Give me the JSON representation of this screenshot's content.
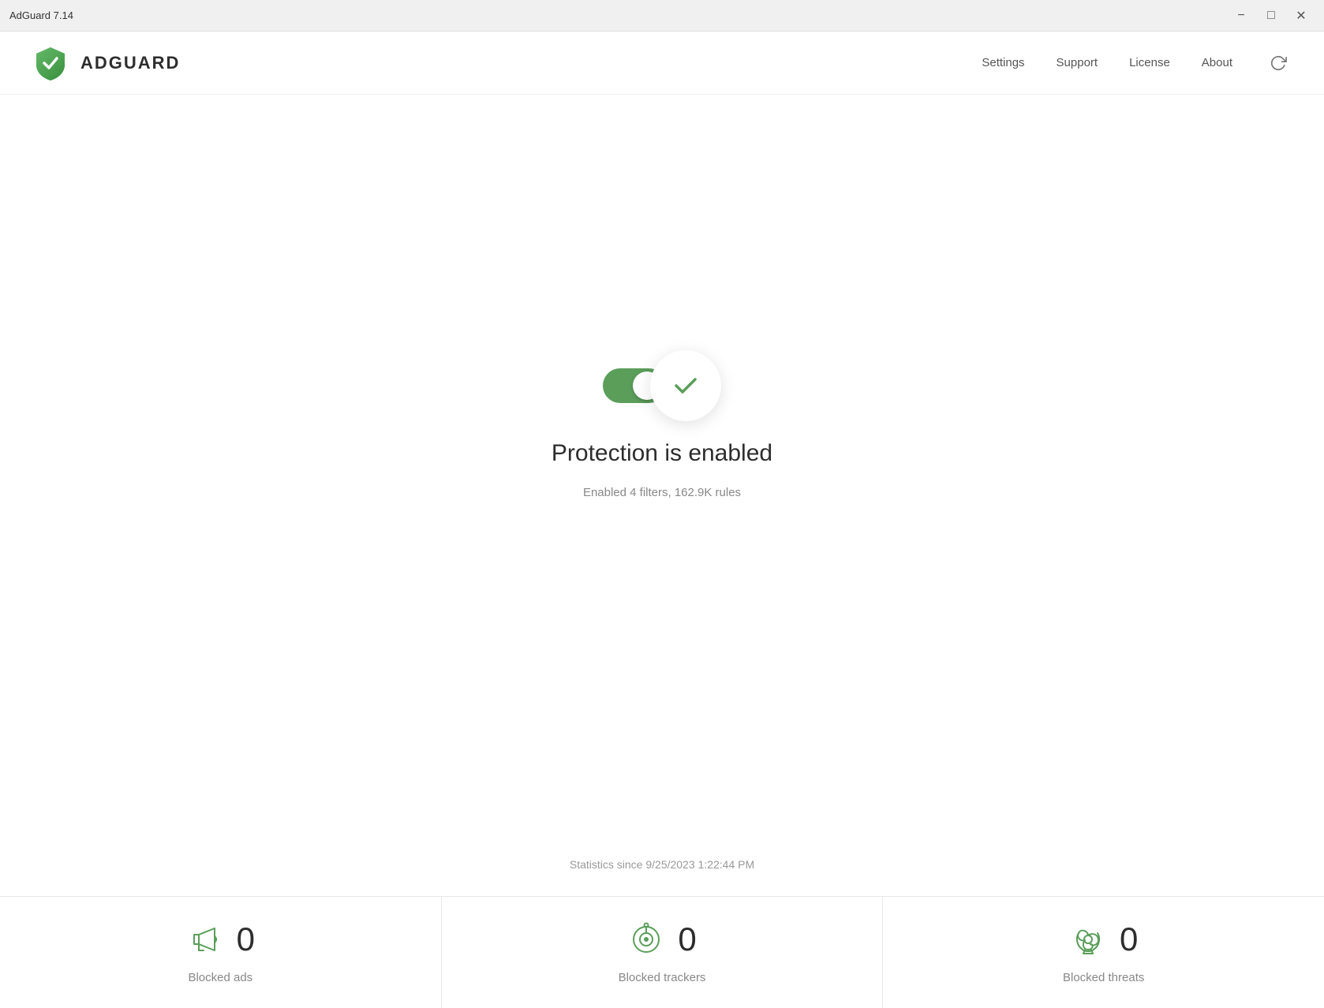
{
  "titlebar": {
    "title": "AdGuard 7.14",
    "minimize_label": "−",
    "maximize_label": "□",
    "close_label": "✕"
  },
  "header": {
    "logo_text": "ADGUARD",
    "nav": {
      "settings": "Settings",
      "support": "Support",
      "license": "License",
      "about": "About"
    }
  },
  "protection": {
    "title": "Protection is enabled",
    "subtitle": "Enabled 4 filters, 162.9K rules",
    "toggle_state": "on"
  },
  "statistics": {
    "since_label": "Statistics since 9/25/2023 1:22:44 PM",
    "items": [
      {
        "count": "0",
        "label": "Blocked ads",
        "icon": "megaphone-icon"
      },
      {
        "count": "0",
        "label": "Blocked trackers",
        "icon": "tracker-icon"
      },
      {
        "count": "0",
        "label": "Blocked threats",
        "icon": "threat-icon"
      }
    ]
  }
}
